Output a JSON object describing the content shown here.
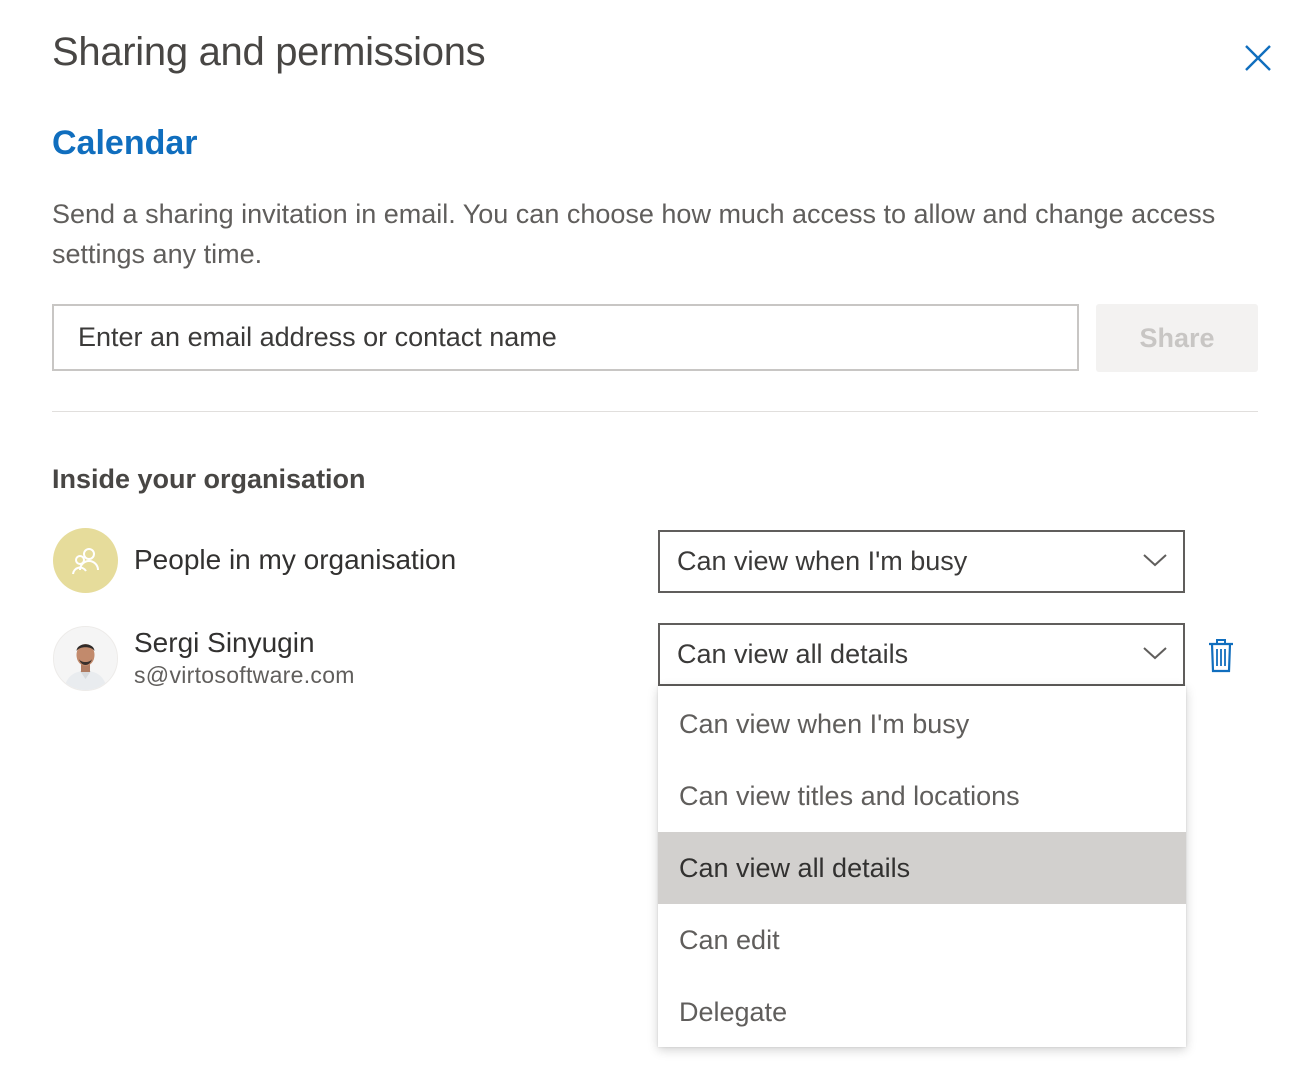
{
  "dialog": {
    "title": "Sharing and permissions",
    "subtitle": "Calendar",
    "description": "Send a sharing invitation in email. You can choose how much access to allow and change access settings any time.",
    "close_icon": "close-icon"
  },
  "invite": {
    "placeholder": "Enter an email address or contact name",
    "value": "",
    "share_label": "Share",
    "share_enabled": false
  },
  "section": {
    "heading": "Inside your organisation"
  },
  "entries": [
    {
      "name": "People in my organisation",
      "avatar": "people-icon",
      "permission": "Can view when I'm busy"
    },
    {
      "name": "Sergi Sinyugin",
      "email": "s@virtosoftware.com",
      "avatar": "user-photo",
      "permission": "Can view all details"
    }
  ],
  "dropdown": {
    "open": true,
    "options": [
      "Can view when I'm busy",
      "Can view titles and locations",
      "Can view all details",
      "Can edit",
      "Delegate"
    ],
    "selected": "Can view all details"
  },
  "colors": {
    "accent": "#106ebe",
    "org_avatar": "#e6dc9b",
    "selected_option": "#d2d0ce",
    "trash": "#106ebe"
  }
}
